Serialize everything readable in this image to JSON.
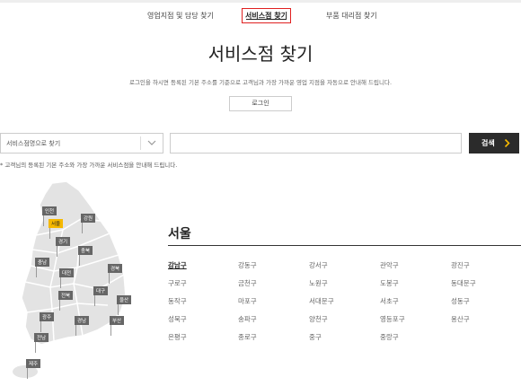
{
  "tabs": [
    {
      "label": "영업지점 및 담당 찾기"
    },
    {
      "label": "서비스점 찾기",
      "active": true
    },
    {
      "label": "부품 대리점 찾기"
    }
  ],
  "page": {
    "title": "서비스점 찾기",
    "description": "로그인을 하시면 등록된 기본 주소를 기준으로 고객님과 가장 가까운 영업 지점을 자동으로 안내해 드립니다.",
    "login_label": "로그인"
  },
  "search": {
    "select_value": "서비스점명으로 찾기",
    "input_value": "",
    "button_label": "검색",
    "note": "* 고객님의 등록된 기본 주소와 가장 가까운 서비스점을 안내해 드립니다."
  },
  "map": {
    "regions": [
      "인천",
      "서울",
      "강원",
      "경기",
      "충북",
      "충남",
      "대전",
      "경북",
      "전북",
      "대구",
      "울산",
      "광주",
      "경남",
      "부산",
      "전남",
      "제주"
    ],
    "selected": "서울",
    "highlight_color": "#f5b800"
  },
  "result": {
    "city": "서울",
    "districts": [
      "강남구",
      "강동구",
      "강서구",
      "관악구",
      "광진구",
      "구로구",
      "금천구",
      "노원구",
      "도봉구",
      "동대문구",
      "동작구",
      "마포구",
      "서대문구",
      "서초구",
      "성동구",
      "성북구",
      "송파구",
      "양천구",
      "영등포구",
      "용산구",
      "은평구",
      "종로구",
      "중구",
      "중랑구"
    ],
    "active_district": "강남구"
  }
}
